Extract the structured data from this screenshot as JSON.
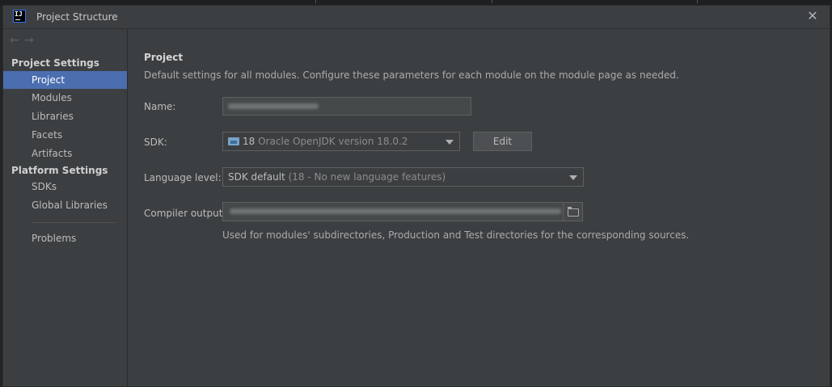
{
  "window": {
    "title": "Project Structure",
    "app_icon": "IJ",
    "close_icon": "close-icon"
  },
  "sidebar": {
    "back_arrow": "←",
    "forward_arrow": "→",
    "project_settings_title": "Project Settings",
    "project_items": [
      "Project",
      "Modules",
      "Libraries",
      "Facets",
      "Artifacts"
    ],
    "platform_settings_title": "Platform Settings",
    "platform_items": [
      "SDKs",
      "Global Libraries"
    ],
    "problems": "Problems",
    "selected": "Project"
  },
  "main": {
    "title": "Project",
    "description": "Default settings for all modules. Configure these parameters for each module on the module page as needed.",
    "name_label": "Name:",
    "name_value": "",
    "sdk_label": "SDK:",
    "sdk_version": "18",
    "sdk_name": "Oracle OpenJDK version 18.0.2",
    "edit_button": "Edit",
    "language_level_label": "Language level:",
    "language_level_value": "SDK default",
    "language_level_detail": "(18 - No new language features)",
    "compiler_output_label": "Compiler output:",
    "compiler_output_value": "",
    "compiler_output_hint": "Used for modules' subdirectories, Production and Test directories for the corresponding sources."
  },
  "colors": {
    "selection": "#4b6eaf",
    "background": "#3c3f41",
    "text": "#bbbbbb"
  }
}
